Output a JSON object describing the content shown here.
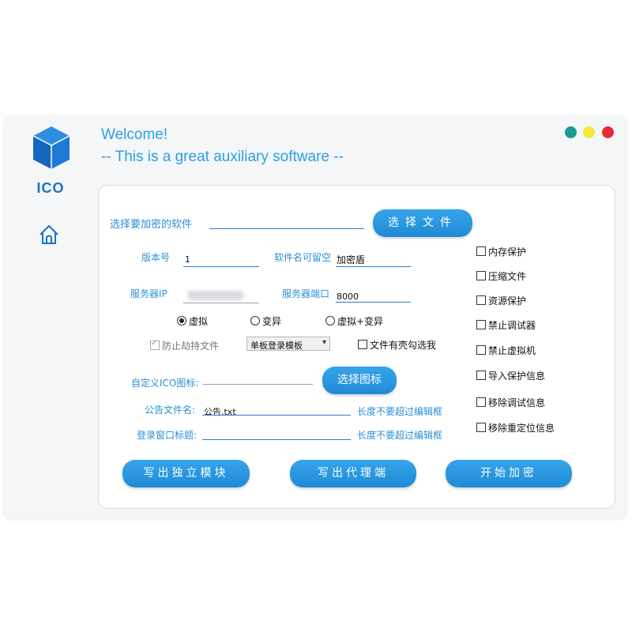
{
  "header": {
    "logo_text": "ICO",
    "welcome": "Welcome!",
    "subtitle": "-- This is a great auxiliary software --"
  },
  "window_controls": [
    "teal",
    "yellow",
    "red"
  ],
  "colors": {
    "accent": "#2a8fd6",
    "button": "#1f8ad6",
    "teal": "#169b8f",
    "yellow": "#f5e63a",
    "red": "#e8293a"
  },
  "form": {
    "select_software_label": "选择要加密的软件",
    "select_software_value": "",
    "select_file_button": "选择文件",
    "version_label": "版本号",
    "version_value": "1",
    "software_name_label": "软件名可留空",
    "software_name_value": "加密盾",
    "server_ip_label": "服务器IP",
    "server_ip_value": "",
    "server_port_label": "服务器端口",
    "server_port_value": "8000",
    "radios": [
      {
        "label": "虚拟",
        "checked": true
      },
      {
        "label": "变异",
        "checked": false
      },
      {
        "label": "虚拟+变异",
        "checked": false
      }
    ],
    "anti_hijack_label": "防止劫持文件",
    "anti_hijack_checked": true,
    "template_select": "单板登录模板",
    "shell_check_label": "文件有壳勾选我",
    "custom_ico_label": "自定义ICO图标:",
    "custom_ico_value": "",
    "select_icon_button": "选择图标",
    "notice_file_label": "公告文件名:",
    "notice_file_value": "公告.txt",
    "notice_hint": "长度不要超过编辑框",
    "login_title_label": "登录窗口标题:",
    "login_title_value": "",
    "login_hint": "长度不要超过编辑框"
  },
  "options": [
    {
      "label": "内存保护",
      "checked": false
    },
    {
      "label": "压缩文件",
      "checked": false
    },
    {
      "label": "资源保护",
      "checked": false
    },
    {
      "label": "禁止调试器",
      "checked": false
    },
    {
      "label": "禁止虚拟机",
      "checked": false
    },
    {
      "label": "导入保护信息",
      "checked": false
    },
    {
      "label": "移除调试信息",
      "checked": false
    },
    {
      "label": "移除重定位信息",
      "checked": false
    }
  ],
  "actions": {
    "write_module": "写出独立模块",
    "write_proxy": "写出代理端",
    "start_encrypt": "开始加密"
  }
}
